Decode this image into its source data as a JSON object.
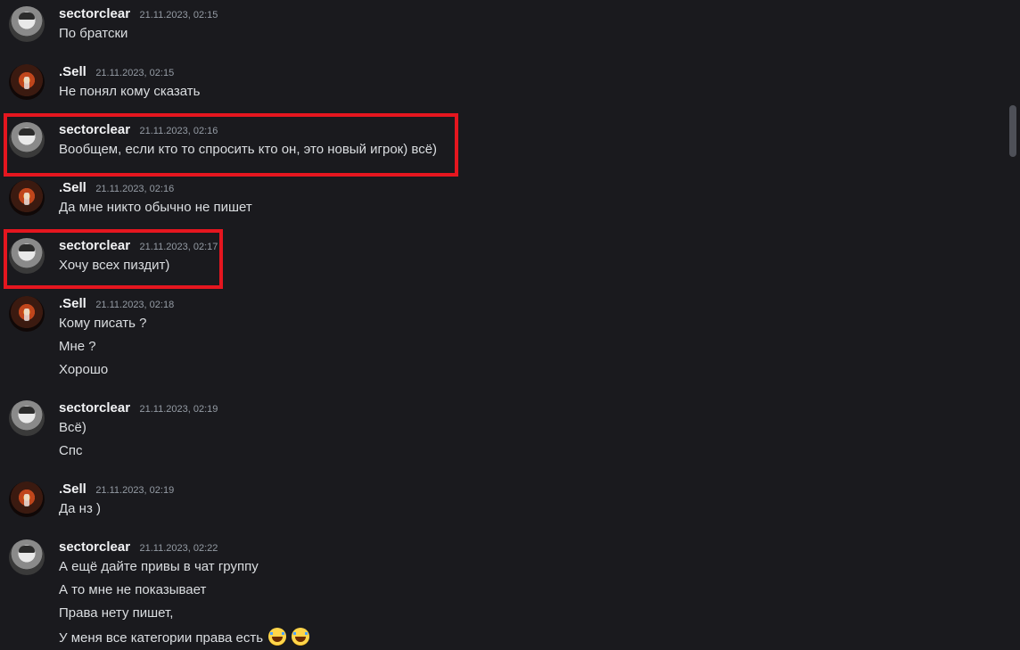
{
  "messages": [
    {
      "author": "sectorclear",
      "time": "21.11.2023, 02:15",
      "lines": [
        "По братски"
      ]
    },
    {
      "author": ".Sell",
      "time": "21.11.2023, 02:15",
      "lines": [
        "Не понял кому сказать"
      ]
    },
    {
      "author": "sectorclear",
      "time": "21.11.2023, 02:16",
      "lines": [
        "Вообщем, если кто то спросить кто он,  это новый игрок) всё)"
      ]
    },
    {
      "author": ".Sell",
      "time": "21.11.2023, 02:16",
      "lines": [
        "Да мне никто обычно не пишет"
      ]
    },
    {
      "author": "sectorclear",
      "time": "21.11.2023, 02:17",
      "lines": [
        "Хочу всех пиздит)"
      ]
    },
    {
      "author": ".Sell",
      "time": "21.11.2023, 02:18",
      "lines": [
        "Кому писать ?",
        "Мне ?",
        "Хорошо"
      ]
    },
    {
      "author": "sectorclear",
      "time": "21.11.2023, 02:19",
      "lines": [
        "Всё)",
        "Спс"
      ]
    },
    {
      "author": ".Sell",
      "time": "21.11.2023, 02:19",
      "lines": [
        "Да нз )"
      ]
    },
    {
      "author": "sectorclear",
      "time": "21.11.2023, 02:22",
      "lines": [
        "А ещё дайте привы в чат группу",
        "А то мне не показывает",
        "Права нету пишет,",
        "У меня все категории права есть"
      ]
    }
  ],
  "emoji": [
    "joy-emoji",
    "joy-emoji"
  ],
  "colors": {
    "background": "#1a1a1e",
    "highlight": "#e5161f",
    "username": "#f2f3f5",
    "timestamp": "#949ba4"
  }
}
